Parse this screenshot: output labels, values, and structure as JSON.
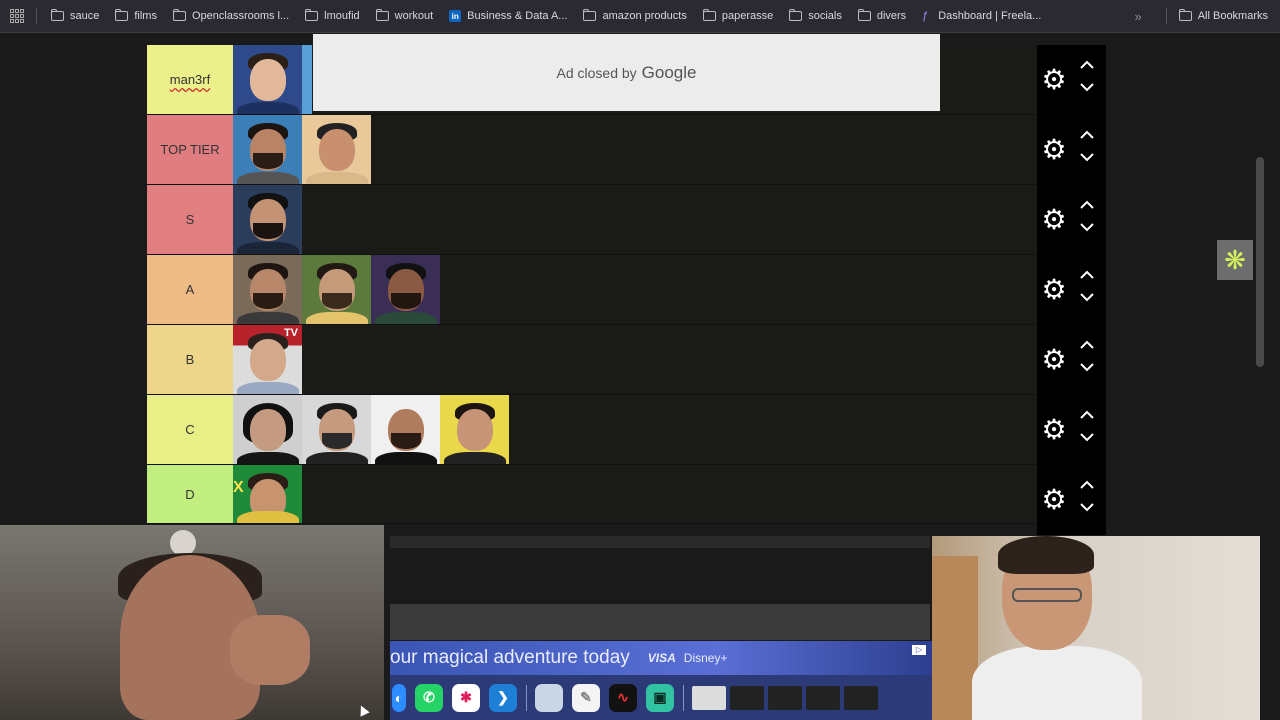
{
  "bookmarks": {
    "items": [
      {
        "label": "sauce",
        "icon": "folder-icon"
      },
      {
        "label": "films",
        "icon": "folder-icon"
      },
      {
        "label": "Openclassrooms l...",
        "icon": "folder-icon"
      },
      {
        "label": "lmoufid",
        "icon": "folder-icon"
      },
      {
        "label": "workout",
        "icon": "folder-icon"
      },
      {
        "label": "Business & Data A...",
        "icon": "linkedin-icon"
      },
      {
        "label": "amazon products",
        "icon": "folder-icon"
      },
      {
        "label": "paperasse",
        "icon": "folder-icon"
      },
      {
        "label": "socials",
        "icon": "folder-icon"
      },
      {
        "label": "divers",
        "icon": "folder-icon"
      },
      {
        "label": "Dashboard | Freela...",
        "icon": "freelance-icon"
      }
    ],
    "more": "»",
    "all_bookmarks": "All Bookmarks"
  },
  "ad": {
    "text": "Ad closed by",
    "brand": "Google"
  },
  "tiers": [
    {
      "label": "man3rf",
      "color": "#ebf08a"
    },
    {
      "label": "TOP TIER",
      "color": "#e07d80"
    },
    {
      "label": "S",
      "color": "#e17f80"
    },
    {
      "label": "A",
      "color": "#eebb86"
    },
    {
      "label": "B",
      "color": "#edd68a"
    },
    {
      "label": "C",
      "color": "#e8ef86"
    },
    {
      "label": "D",
      "color": "#c2ee80"
    }
  ],
  "face_tv": "TV",
  "face_gx": "X",
  "banner": {
    "text": "our magical adventure today",
    "visa": "VISA",
    "dplus": "Disney+"
  },
  "colors": {
    "accent_widget": "#d3f35a",
    "controls_bg": "#000000"
  }
}
